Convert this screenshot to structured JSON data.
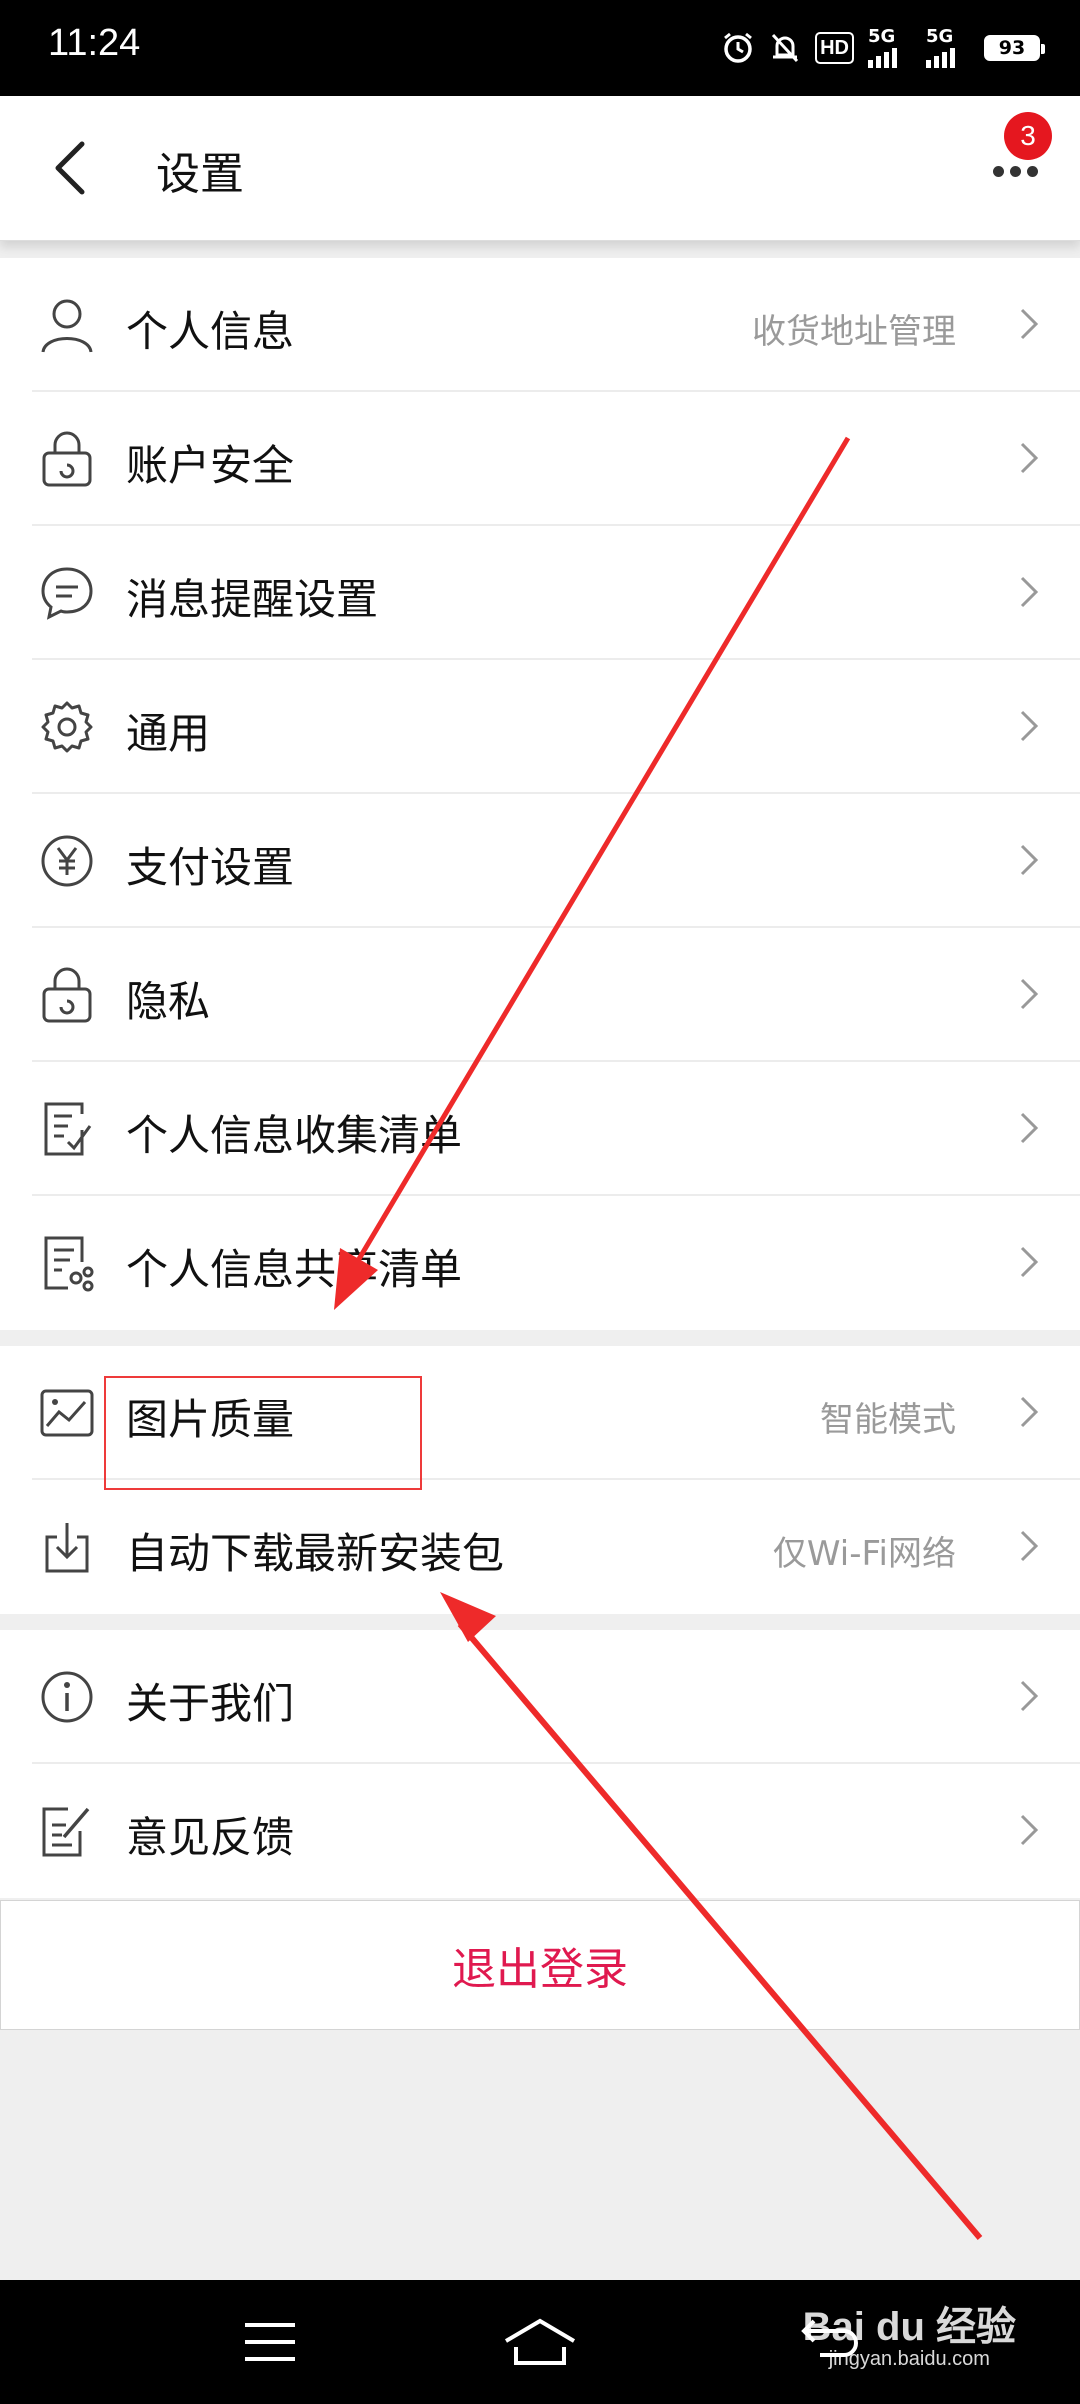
{
  "status_bar": {
    "time": "11:24",
    "hd_label": "HD",
    "sim1_label": "5G",
    "sim2_label": "5G",
    "battery": "93",
    "icons": [
      "alarm-icon",
      "mute-icon",
      "hd-icon",
      "signal-icon",
      "signal-icon",
      "battery-icon"
    ]
  },
  "header": {
    "title": "设置",
    "back_icon": "chevron-left-icon",
    "more_icon": "more-dots-icon",
    "badge_count": "3"
  },
  "groups": [
    {
      "items": [
        {
          "label": "个人信息",
          "value": "收货地址管理",
          "icon": "user-icon"
        },
        {
          "label": "账户安全",
          "value": "",
          "icon": "lock-icon"
        },
        {
          "label": "消息提醒设置",
          "value": "",
          "icon": "message-icon"
        },
        {
          "label": "通用",
          "value": "",
          "icon": "gear-icon"
        },
        {
          "label": "支付设置",
          "value": "",
          "icon": "yuan-icon"
        },
        {
          "label": "隐私",
          "value": "",
          "icon": "lock-icon"
        },
        {
          "label": "个人信息收集清单",
          "value": "",
          "icon": "checklist-icon"
        },
        {
          "label": "个人信息共享清单",
          "value": "",
          "icon": "share-list-icon"
        }
      ]
    },
    {
      "items": [
        {
          "label": "图片质量",
          "value": "智能模式",
          "icon": "image-icon"
        },
        {
          "label": "自动下载最新安装包",
          "value": "仅Wi-Fi网络",
          "icon": "download-icon"
        }
      ]
    },
    {
      "items": [
        {
          "label": "关于我们",
          "value": "",
          "icon": "info-icon"
        },
        {
          "label": "意见反馈",
          "value": "",
          "icon": "feedback-icon"
        }
      ]
    }
  ],
  "logout_label": "退出登录",
  "nav_bar": {
    "icons": [
      "menu-icon",
      "home-icon",
      "back-icon"
    ]
  },
  "watermark": {
    "logo": "Bai du 经验",
    "url": "jingyan.baidu.com"
  },
  "colors": {
    "accent": "#e0194f",
    "badge": "#e5171f",
    "annotation": "#ee3a3a",
    "value_text": "#9a9a9a",
    "background": "#efefef"
  }
}
